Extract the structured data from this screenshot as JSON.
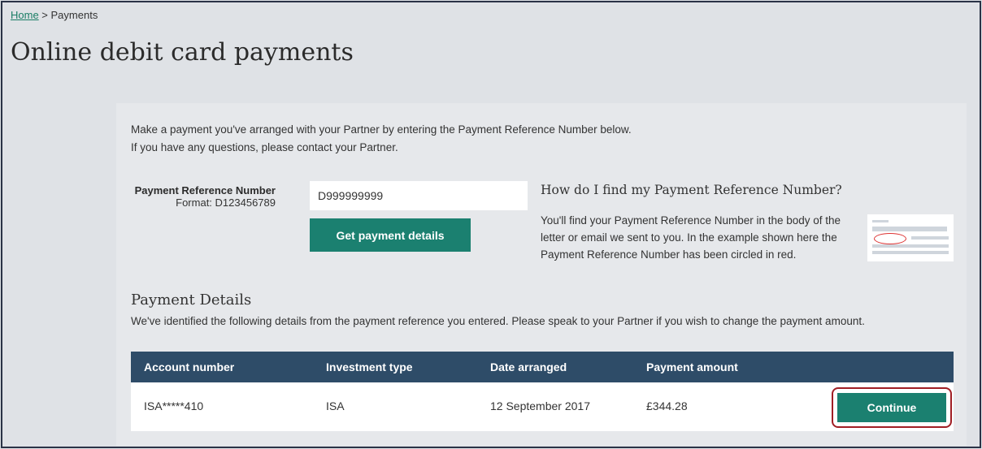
{
  "breadcrumb": {
    "home": "Home",
    "sep": " > ",
    "current": "Payments"
  },
  "page_title": "Online debit card payments",
  "intro": {
    "line1": "Make a payment you've arranged with your Partner by entering the Payment Reference Number below.",
    "line2": "If you have any questions, please contact your Partner."
  },
  "prn": {
    "label": "Payment Reference Number",
    "format": "Format: D123456789",
    "value": "D999999999",
    "button": "Get payment details"
  },
  "help": {
    "title": "How do I find my Payment Reference Number?",
    "text": "You'll find your Payment Reference Number in the body of the letter or email we sent to you. In the example shown here the Payment Reference Number has been circled in red."
  },
  "details": {
    "title": "Payment Details",
    "text": "We've identified the following details from the payment reference you entered. Please speak to your Partner if you wish to change the payment amount."
  },
  "table": {
    "headers": [
      "Account number",
      "Investment type",
      "Date arranged",
      "Payment amount"
    ],
    "row": {
      "account": "ISA*****410",
      "type": "ISA",
      "date": "12 September 2017",
      "amount": "£344.28"
    },
    "continue": "Continue"
  },
  "colors": {
    "accent": "#1b8070",
    "header": "#2e4c68",
    "highlight": "#a01e24"
  }
}
